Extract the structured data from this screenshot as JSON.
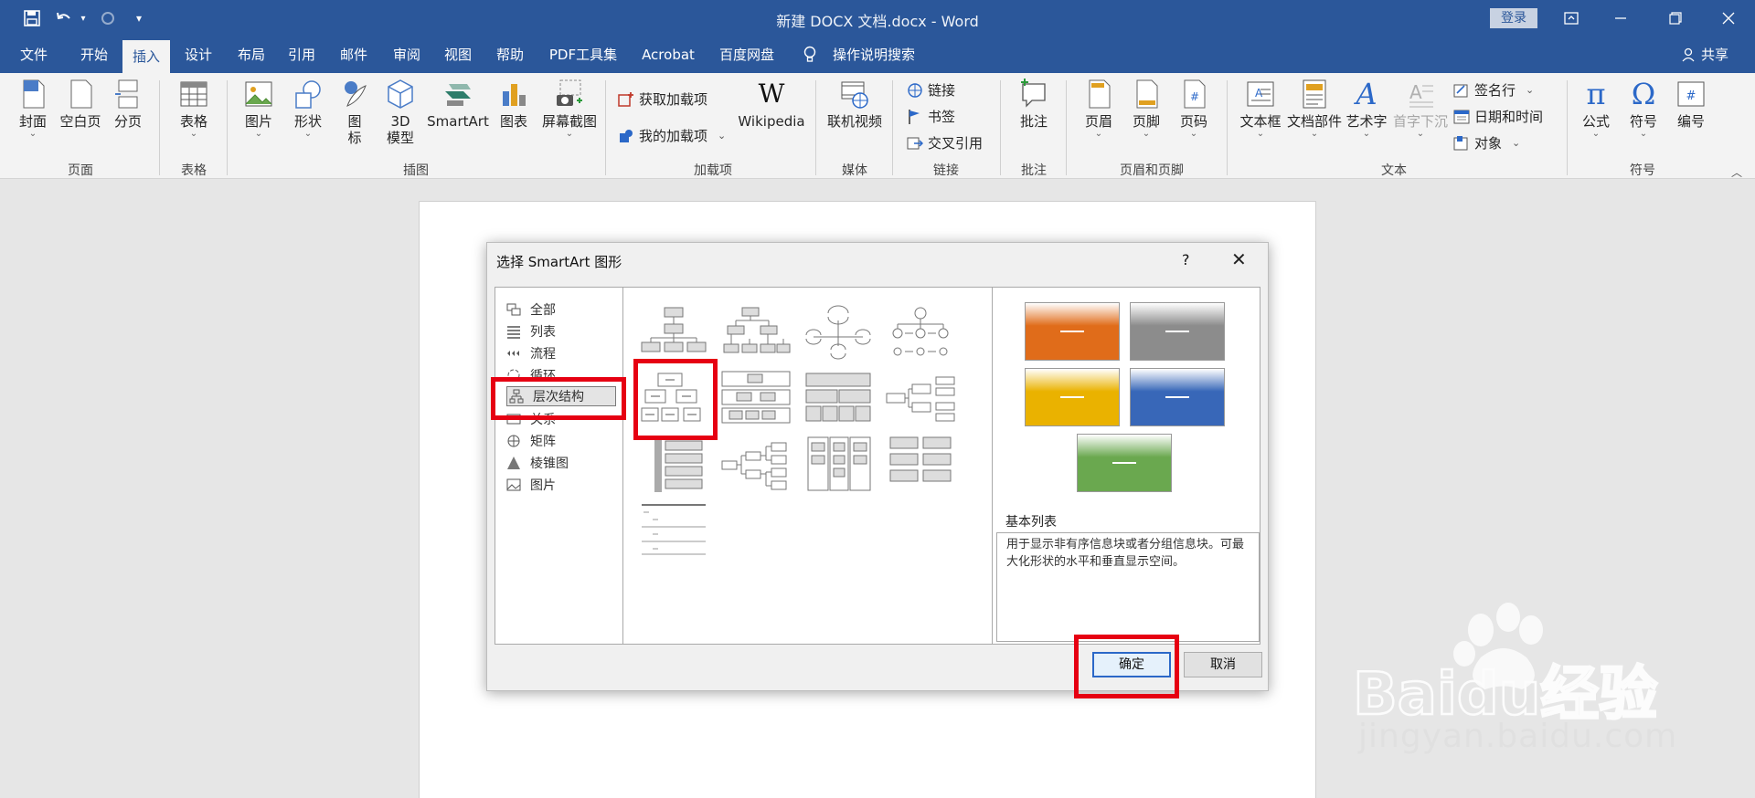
{
  "window": {
    "title": "新建 DOCX 文档.docx  -  Word",
    "login": "登录",
    "quick_access": [
      "save-icon",
      "undo-icon",
      "redo-icon",
      "customize-icon"
    ]
  },
  "tabs": [
    "文件",
    "开始",
    "插入",
    "设计",
    "布局",
    "引用",
    "邮件",
    "审阅",
    "视图",
    "帮助",
    "PDF工具集",
    "Acrobat",
    "百度网盘"
  ],
  "active_tab": "插入",
  "tell_me": "操作说明搜索",
  "share": "共享",
  "ribbon": {
    "pages": {
      "cover": "封面",
      "blank": "空白页",
      "break": "分页",
      "group": "页面"
    },
    "tables": {
      "table": "表格",
      "group": "表格"
    },
    "illustrations": {
      "pictures": "图片",
      "shapes": "形状",
      "icons": "图\n标",
      "model3d": "3D\n模型",
      "smartart": "SmartArt",
      "chart": "图表",
      "screenshot": "屏幕截图",
      "group": "插图"
    },
    "addins": {
      "get": "获取加载项",
      "mine": "我的加载项",
      "wikipedia": "Wikipedia",
      "group": "加载项"
    },
    "media": {
      "video": "联机视频",
      "group": "媒体"
    },
    "links": {
      "link": "链接",
      "bookmark": "书签",
      "crossref": "交叉引用",
      "group": "链接"
    },
    "comments": {
      "comment": "批注",
      "group": "批注"
    },
    "header_footer": {
      "header": "页眉",
      "footer": "页脚",
      "page_number": "页码",
      "group": "页眉和页脚"
    },
    "text": {
      "textbox": "文本框",
      "quickparts": "文档部件",
      "wordart": "艺术字",
      "dropcap": "首字下沉",
      "signature": "签名行",
      "datetime": "日期和时间",
      "object": "对象",
      "group": "文本"
    },
    "symbols": {
      "equation": "公式",
      "symbol": "符号",
      "numbering": "编号",
      "group": "符号"
    }
  },
  "dialog": {
    "title": "选择 SmartArt 图形",
    "help": "?",
    "categories": [
      "全部",
      "列表",
      "流程",
      "循环",
      "层次结构",
      "关系",
      "矩阵",
      "棱锥图",
      "图片"
    ],
    "selected_category": "层次结构",
    "preview_title": "基本列表",
    "preview_description": "用于显示非有序信息块或者分组信息块。可最大化形状的水平和垂直显示空间。",
    "preview_colors": [
      "#e06c1a",
      "#8c8c8c",
      "#eab200",
      "#3867b8",
      "#6aa84f"
    ],
    "ok": "确定",
    "cancel": "取消"
  },
  "watermark": {
    "brand": "Baidu经验",
    "url": "jingyan.baidu.com"
  }
}
